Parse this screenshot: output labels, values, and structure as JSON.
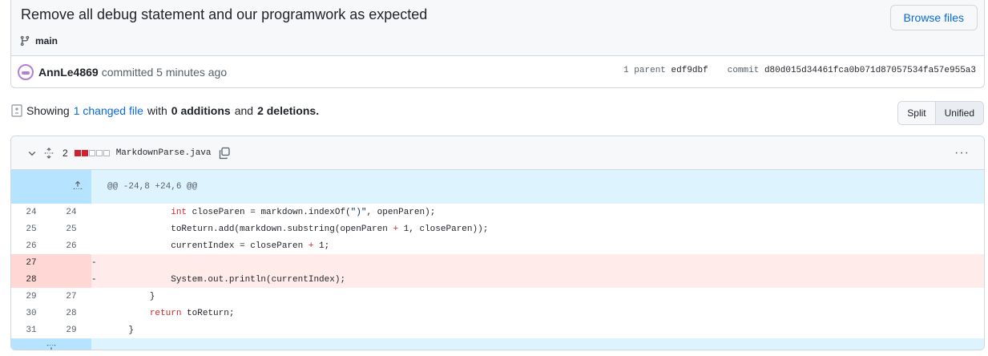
{
  "commit": {
    "title": "Remove all debug statement and our programwork as expected",
    "branch": "main",
    "browse_label": "Browse files",
    "author": "AnnLe4869",
    "committed_text": "committed 5 minutes ago",
    "parent_label": "1 parent",
    "parent_hash": "edf9dbf",
    "commit_label": "commit",
    "commit_hash": "d80d015d34461fca0b071d87057534fa57e955a3"
  },
  "summary": {
    "showing": "Showing",
    "changed_files": "1 changed file",
    "with": "with",
    "additions": "0 additions",
    "and": "and",
    "deletions": "2 deletions."
  },
  "view_toggle": {
    "split": "Split",
    "unified": "Unified"
  },
  "file": {
    "change_count": "2",
    "name": "MarkdownParse.java",
    "hunk_header": "@@ -24,8 +24,6 @@",
    "diffstat": [
      "deleted",
      "deleted",
      "neutral",
      "neutral",
      "neutral"
    ],
    "lines": [
      {
        "old": "24",
        "new": "24",
        "type": "context",
        "mark": "",
        "code": "            int closeParen = markdown.indexOf(\")\", openParen);"
      },
      {
        "old": "25",
        "new": "25",
        "type": "context",
        "mark": "",
        "code": "            toReturn.add(markdown.substring(openParen + 1, closeParen));"
      },
      {
        "old": "26",
        "new": "26",
        "type": "context",
        "mark": "",
        "code": "            currentIndex = closeParen + 1;"
      },
      {
        "old": "27",
        "new": "",
        "type": "del",
        "mark": "-",
        "code": ""
      },
      {
        "old": "28",
        "new": "",
        "type": "del",
        "mark": "-",
        "code": "            System.out.println(currentIndex);"
      },
      {
        "old": "29",
        "new": "27",
        "type": "context",
        "mark": "",
        "code": "        }"
      },
      {
        "old": "30",
        "new": "28",
        "type": "context",
        "mark": "",
        "code": "        return toReturn;"
      },
      {
        "old": "31",
        "new": "29",
        "type": "context",
        "mark": "",
        "code": "    }"
      }
    ]
  },
  "colors": {
    "link": "#0969da",
    "deletion_bg": "#ffebe9",
    "deletion_num_bg": "#ffd7d5",
    "hunk_bg": "#ddf4ff",
    "hunk_expand_bg": "#b6e3ff",
    "diffstat_red": "#cf222e"
  }
}
